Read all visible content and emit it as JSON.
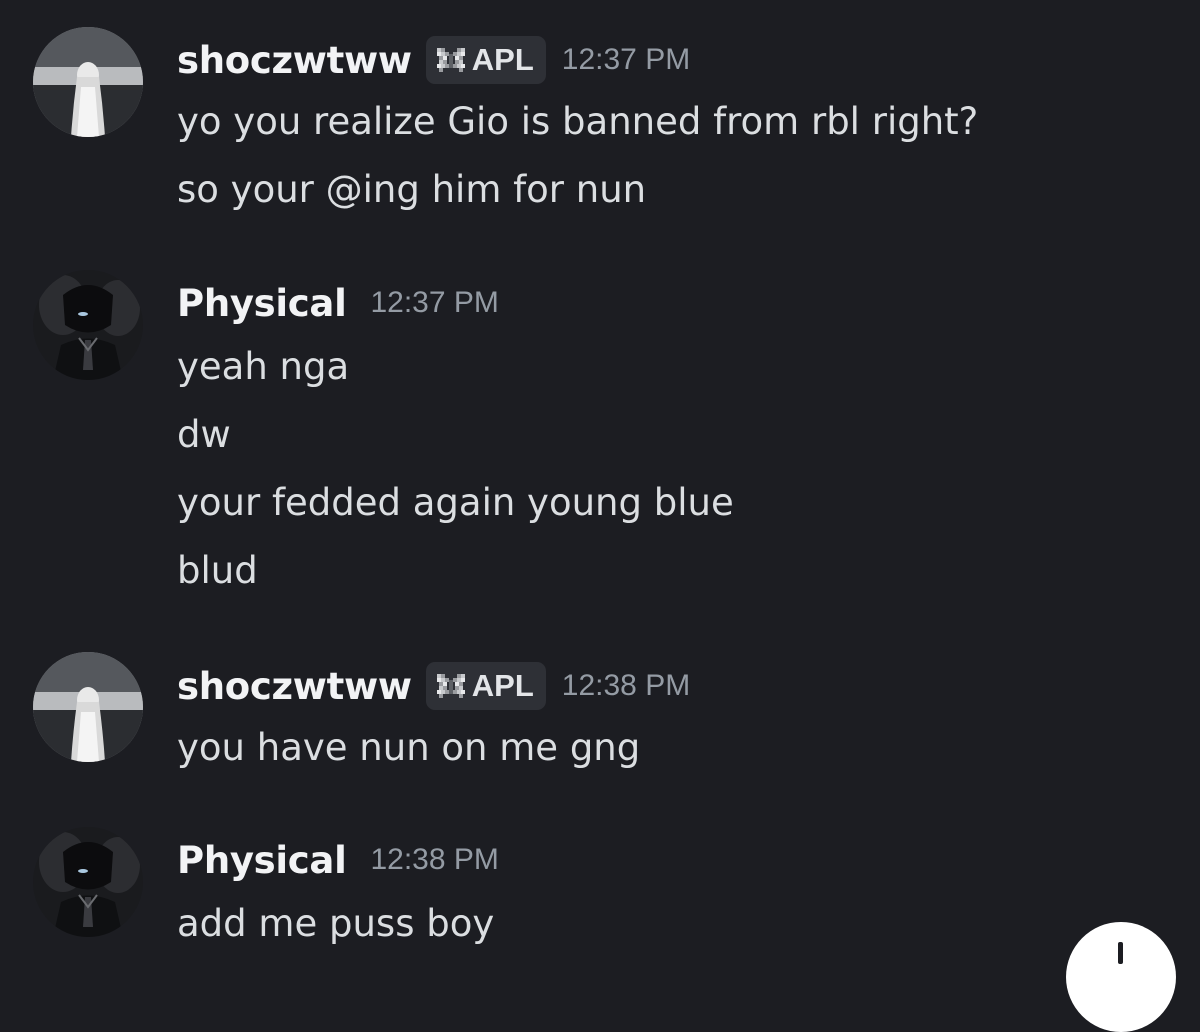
{
  "messages": [
    {
      "author": "shoczwtww",
      "avatar": "anime-girl-avatar",
      "tag": {
        "icon": "butterfly-icon",
        "label": "APL"
      },
      "time": "12:37 PM",
      "lines": [
        "yo you realize Gio is banned from rbl right?",
        "so your @ing him for nun"
      ]
    },
    {
      "author": "Physical",
      "avatar": "dark-anime-boy-avatar",
      "time": "12:37 PM",
      "lines": [
        "yeah nga",
        "dw",
        "your fedded again young blue",
        "blud"
      ]
    },
    {
      "author": "shoczwtww",
      "avatar": "anime-girl-avatar",
      "tag": {
        "icon": "butterfly-icon",
        "label": "APL"
      },
      "time": "12:38 PM",
      "lines": [
        "you have nun on me gng"
      ]
    },
    {
      "author": "Physical",
      "avatar": "dark-anime-boy-avatar",
      "time": "12:38 PM",
      "lines": [
        "add me puss boy"
      ]
    }
  ],
  "colors": {
    "background": "#1c1d22",
    "username": "#f2f3f5",
    "message_text": "#dbdee1",
    "timestamp": "#949ba4",
    "tag_background": "#2e3036"
  },
  "fab": {
    "icon": "plus-icon"
  }
}
